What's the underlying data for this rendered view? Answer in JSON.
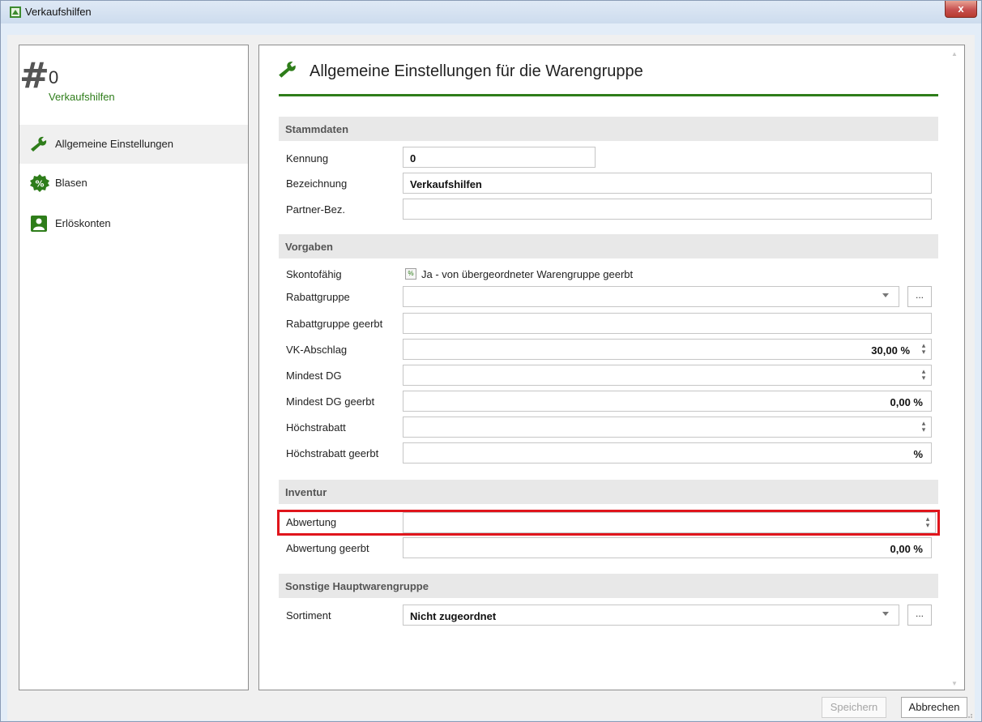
{
  "window": {
    "title": "Verkaufshilfen",
    "close_label": "x"
  },
  "left": {
    "hash_symbol": "#",
    "id_number": "0",
    "id_subtitle": "Verkaufshilfen",
    "nav": [
      {
        "label": "Allgemeine Einstellungen",
        "icon": "wrench-icon",
        "active": true
      },
      {
        "label": "Blasen",
        "icon": "percent-badge-icon",
        "active": false
      },
      {
        "label": "Erlöskonten",
        "icon": "account-card-icon",
        "active": false
      }
    ]
  },
  "main": {
    "title": "Allgemeine Einstellungen für die Warengruppe",
    "sections": {
      "stammdaten": "Stammdaten",
      "vorgaben": "Vorgaben",
      "inventur": "Inventur",
      "sonstige": "Sonstige Hauptwarengruppe"
    },
    "fields": {
      "kennung": {
        "label": "Kennung",
        "value": "0"
      },
      "bezeichnung": {
        "label": "Bezeichnung",
        "value": "Verkaufshilfen"
      },
      "partner": {
        "label": "Partner-Bez.",
        "value": ""
      },
      "skonto": {
        "label": "Skontofähig",
        "check_glyph": "%",
        "text": "Ja - von übergeordneter Warengruppe geerbt"
      },
      "rabattgruppe": {
        "label": "Rabattgruppe",
        "value": "",
        "button": "..."
      },
      "rabattgruppe_geerbt": {
        "label": "Rabattgruppe geerbt",
        "value": ""
      },
      "vk_abschlag": {
        "label": "VK-Abschlag",
        "value": "30,00 %"
      },
      "mindest_dg": {
        "label": "Mindest DG",
        "value": ""
      },
      "mindest_dg_geerbt": {
        "label": "Mindest DG geerbt",
        "value": "0,00 %"
      },
      "hoechstrabatt": {
        "label": "Höchstrabatt",
        "value": ""
      },
      "hoechstrabatt_geerbt": {
        "label": "Höchstrabatt geerbt",
        "value": "%"
      },
      "abwertung": {
        "label": "Abwertung",
        "value": ""
      },
      "abwertung_geerbt": {
        "label": "Abwertung geerbt",
        "value": "0,00 %"
      },
      "sortiment": {
        "label": "Sortiment",
        "value": "Nicht zugeordnet",
        "button": "..."
      }
    }
  },
  "footer": {
    "save_label": "Speichern",
    "save_enabled": false,
    "cancel_label": "Abbrechen"
  },
  "colors": {
    "accent_green": "#2e7d1a",
    "highlight_red": "#e0151c",
    "close_red": "#c75050"
  }
}
